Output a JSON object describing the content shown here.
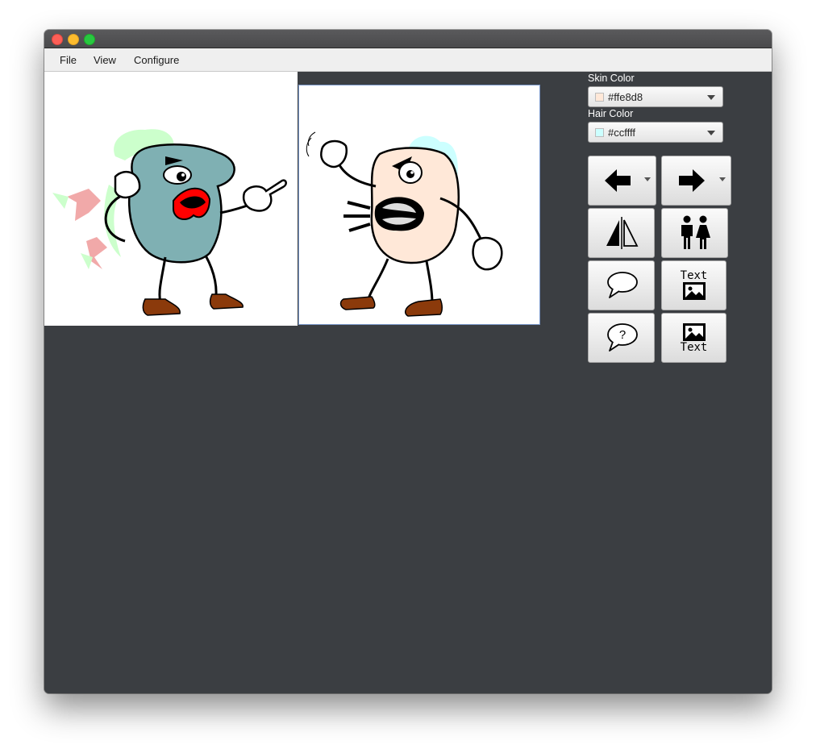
{
  "menu": {
    "items": [
      "File",
      "View",
      "Configure"
    ]
  },
  "sidebar": {
    "skin_label": "Skin Color",
    "skin_value": "#ffe8d8",
    "hair_label": "Hair Color",
    "hair_value": "#ccffff"
  },
  "buttons": {
    "text_above_label": "Text",
    "text_below_label": "Text",
    "question_mark": "?"
  },
  "colors": {
    "skin": "#ffe8d8",
    "hair": "#ccffff",
    "left_skin": "#7fb0b3",
    "left_hair": "#ccffcc",
    "bow": "#f0a0a0",
    "shoes": "#8b3a0b",
    "lips": "#ff0000",
    "canvas_bg": "#3b3e42",
    "selection": "#7b98c9"
  },
  "icons": [
    "arrow-left-icon",
    "arrow-right-icon",
    "flip-icon",
    "people-icon",
    "speech-bubble-icon",
    "text-above-image-icon",
    "thought-bubble-icon",
    "text-below-image-icon"
  ]
}
